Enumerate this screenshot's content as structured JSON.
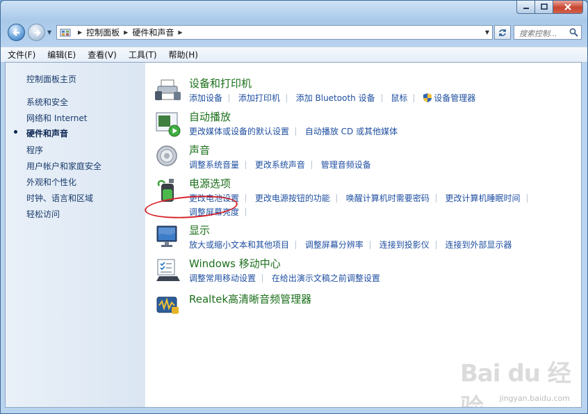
{
  "titlebar": {
    "min_icon": "minimize-icon",
    "max_icon": "maximize-icon",
    "close_icon": "close-icon"
  },
  "nav": {
    "breadcrumb": [
      "控制面板",
      "硬件和声音"
    ],
    "search_placeholder": "搜索控制..."
  },
  "menubar": [
    "文件(F)",
    "编辑(E)",
    "查看(V)",
    "工具(T)",
    "帮助(H)"
  ],
  "sidebar": {
    "home": "控制面板主页",
    "items": [
      "系统和安全",
      "网络和 Internet",
      "硬件和声音",
      "程序",
      "用户帐户和家庭安全",
      "外观和个性化",
      "时钟、语言和区域",
      "轻松访问"
    ],
    "current_index": 2
  },
  "categories": [
    {
      "title": "设备和打印机",
      "icon": "printer-icon",
      "links": [
        [
          "添加设备",
          "添加打印机",
          "添加 Bluetooth 设备",
          "鼠标",
          "设备管理器"
        ]
      ]
    },
    {
      "title": "自动播放",
      "icon": "autoplay-icon",
      "links": [
        [
          "更改媒体或设备的默认设置",
          "自动播放 CD 或其他媒体"
        ]
      ]
    },
    {
      "title": "声音",
      "icon": "speaker-icon",
      "links": [
        [
          "调整系统音量",
          "更改系统声音",
          "管理音频设备"
        ]
      ]
    },
    {
      "title": "电源选项",
      "icon": "battery-icon",
      "links": [
        [
          "更改电池设置",
          "更改电源按钮的功能",
          "唤醒计算机时需要密码",
          "更改计算机睡眠时间"
        ],
        [
          "调整屏幕亮度"
        ]
      ]
    },
    {
      "title": "显示",
      "icon": "monitor-icon",
      "links": [
        [
          "放大或缩小文本和其他项目",
          "调整屏幕分辨率",
          "连接到投影仪",
          "连接到外部显示器"
        ]
      ]
    },
    {
      "title": "Windows 移动中心",
      "icon": "mobility-center-icon",
      "links": [
        [
          "调整常用移动设置",
          "在给出演示文稿之前调整设置"
        ]
      ]
    },
    {
      "title": "Realtek高清晰音频管理器",
      "icon": "realtek-audio-icon",
      "links": []
    }
  ],
  "watermark": {
    "text": "Bai du 经验",
    "sub": "jingyan.baidu.com"
  },
  "colors": {
    "title_green": "#1b6f1b",
    "link_blue": "#1f4fa0",
    "highlight_red": "#d6232a"
  }
}
